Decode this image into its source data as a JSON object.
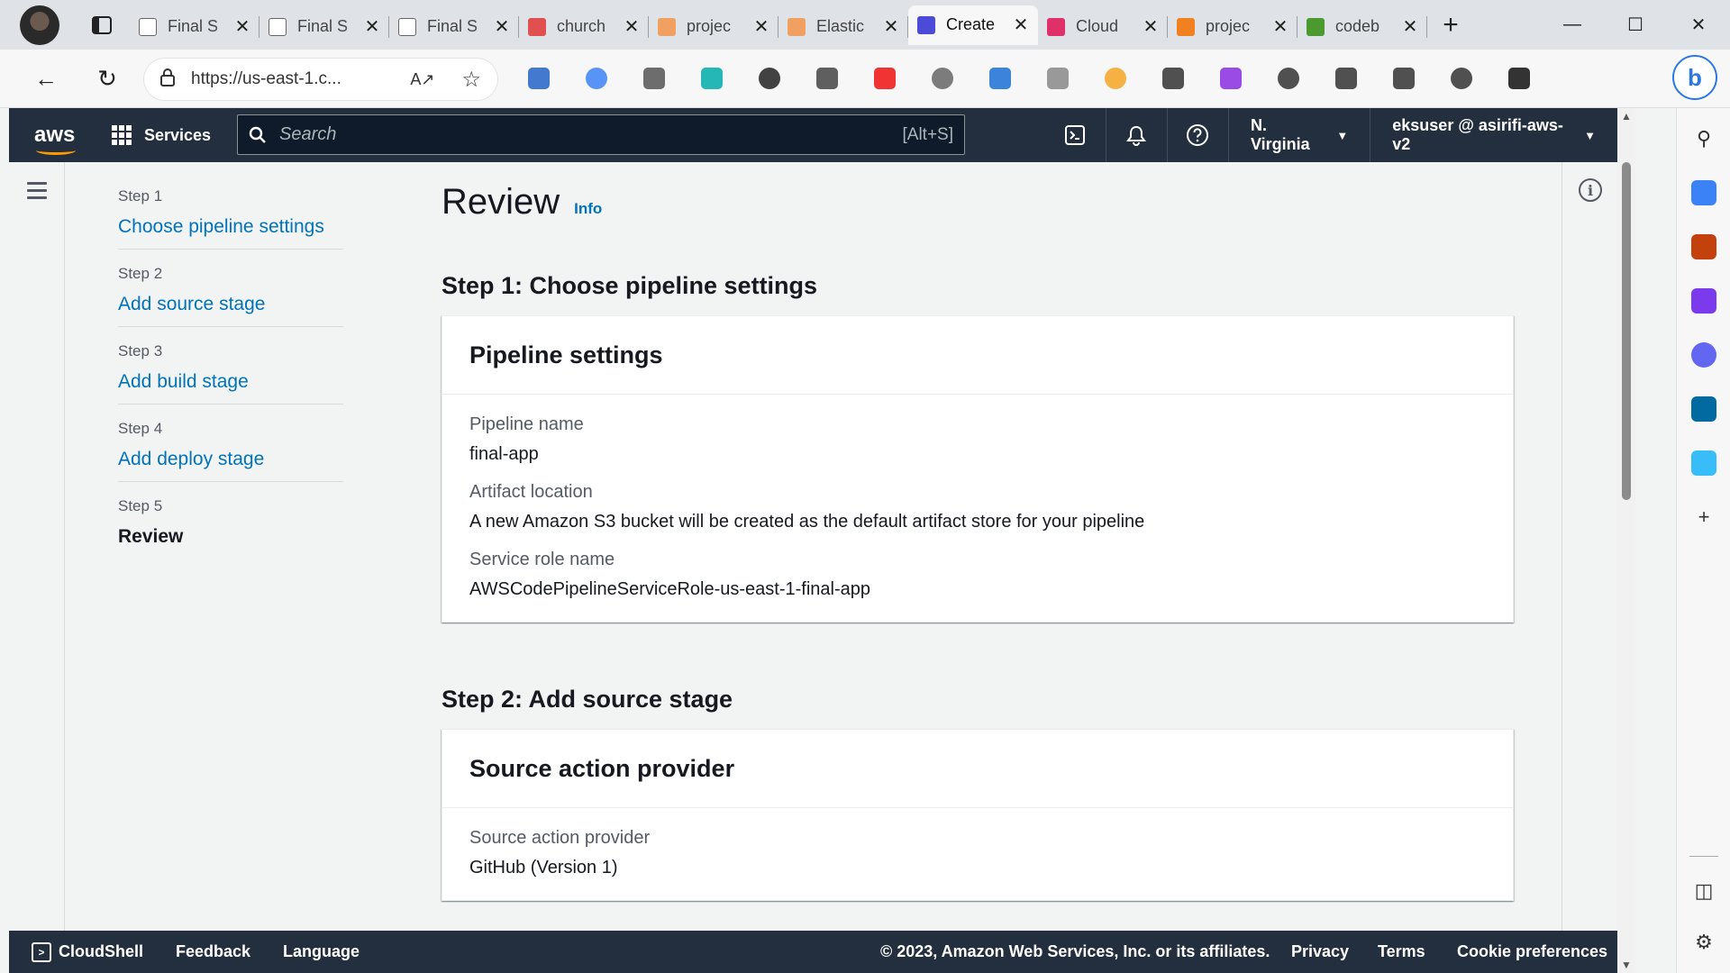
{
  "browser": {
    "tabs": [
      {
        "label": "Final S",
        "icon": "page-icon",
        "color": "#ffffff"
      },
      {
        "label": "Final S",
        "icon": "page-icon",
        "color": "#ffffff"
      },
      {
        "label": "Final S",
        "icon": "page-icon",
        "color": "#ffffff"
      },
      {
        "label": "church",
        "icon": "pdf-icon",
        "color": "#e05050"
      },
      {
        "label": "projec",
        "icon": "aws-orange-icon",
        "color": "#f0a060"
      },
      {
        "label": "Elastic",
        "icon": "aws-orange-icon",
        "color": "#f0a060"
      },
      {
        "label": "Create",
        "icon": "codepipeline-icon",
        "color": "#4b4bd8",
        "active": true
      },
      {
        "label": "Cloud",
        "icon": "cloudwatch-icon",
        "color": "#e0306a"
      },
      {
        "label": "projec",
        "icon": "aws-orange-icon",
        "color": "#f08020"
      },
      {
        "label": "codeb",
        "icon": "leaf-icon",
        "color": "#4a9a30"
      }
    ],
    "address": "https://us-east-1.c...",
    "extension_colors": [
      "#2563c9",
      "#3b82f6",
      "#555555",
      "#0aa",
      "#222222",
      "#444444",
      "#e11",
      "#666",
      "#1a6fd6",
      "#888",
      "#f5a623",
      "#333",
      "#8a2be2",
      "#333",
      "#333",
      "#333",
      "#333",
      "#111"
    ]
  },
  "aws_nav": {
    "logo": "aws",
    "services": "Services",
    "search_placeholder": "Search",
    "search_shortcut": "[Alt+S]",
    "region": "N. Virginia",
    "user": "eksuser @ asirifi-aws-v2"
  },
  "steps": [
    {
      "label": "Step 1",
      "title": "Choose pipeline settings",
      "current": false
    },
    {
      "label": "Step 2",
      "title": "Add source stage",
      "current": false
    },
    {
      "label": "Step 3",
      "title": "Add build stage",
      "current": false
    },
    {
      "label": "Step 4",
      "title": "Add deploy stage",
      "current": false
    },
    {
      "label": "Step 5",
      "title": "Review",
      "current": true
    }
  ],
  "main": {
    "title": "Review",
    "info": "Info",
    "section1": {
      "title": "Step 1: Choose pipeline settings",
      "panel_title": "Pipeline settings",
      "fields": [
        {
          "label": "Pipeline name",
          "value": "final-app"
        },
        {
          "label": "Artifact location",
          "value": "A new Amazon S3 bucket will be created as the default artifact store for your pipeline"
        },
        {
          "label": "Service role name",
          "value": "AWSCodePipelineServiceRole-us-east-1-final-app"
        }
      ]
    },
    "section2": {
      "title": "Step 2: Add source stage",
      "panel_title": "Source action provider",
      "fields": [
        {
          "label": "Source action provider",
          "value": "GitHub (Version 1)"
        }
      ]
    }
  },
  "footer": {
    "cloudshell": "CloudShell",
    "feedback": "Feedback",
    "language": "Language",
    "copyright": "© 2023, Amazon Web Services, Inc. or its affiliates.",
    "privacy": "Privacy",
    "terms": "Terms",
    "cookies": "Cookie preferences"
  }
}
